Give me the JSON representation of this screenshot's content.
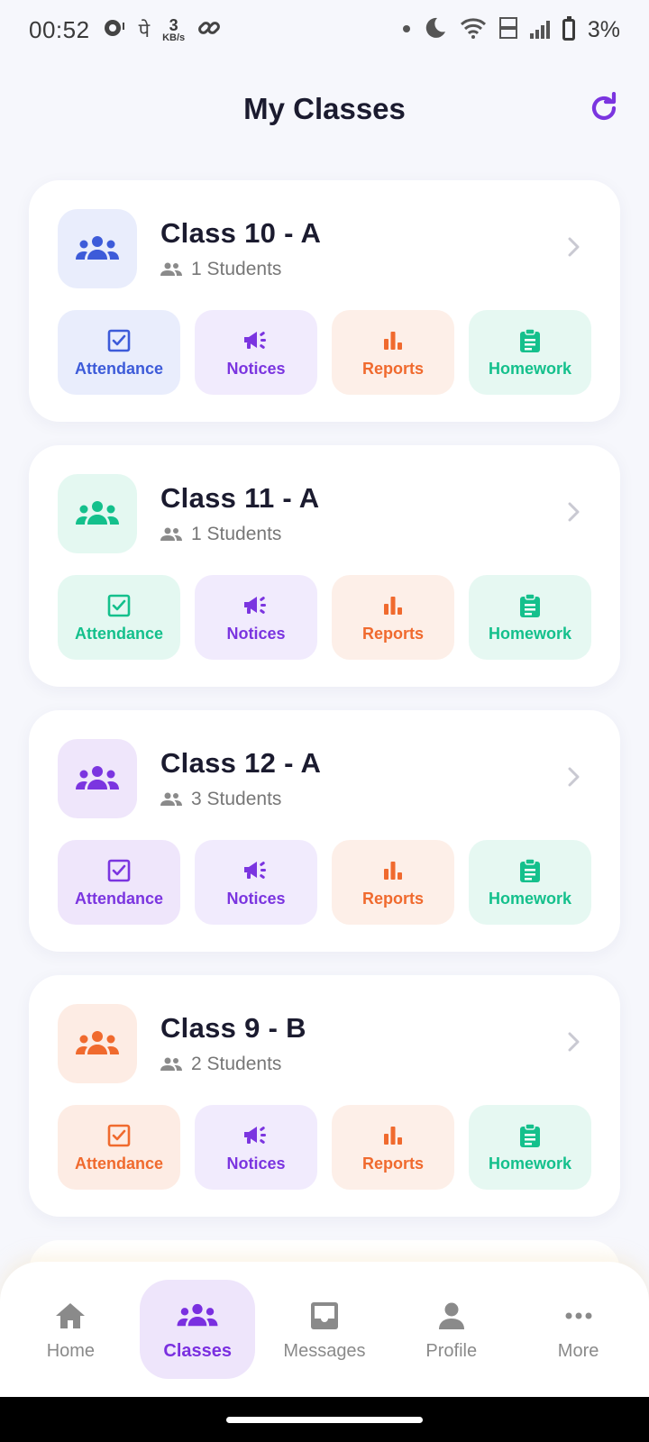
{
  "status_bar": {
    "time": "00:52",
    "net_speed_value": "3",
    "net_speed_unit": "KB/s",
    "hindi_glyph": "पे",
    "battery_percent": "3%"
  },
  "header": {
    "title": "My Classes",
    "refresh_icon": "refresh-icon"
  },
  "action_labels": {
    "attendance": "Attendance",
    "notices": "Notices",
    "reports": "Reports",
    "homework": "Homework"
  },
  "classes": [
    {
      "name": "Class 10 - A",
      "students": "1 Students",
      "accent": "#3d5bd9",
      "avatar_bg": "#e9edfc"
    },
    {
      "name": "Class 11 - A",
      "students": "1 Students",
      "accent": "#14c08c",
      "avatar_bg": "#e4f8f1"
    },
    {
      "name": "Class 12 - A",
      "students": "3 Students",
      "accent": "#7b35e0",
      "avatar_bg": "#efe6fb"
    },
    {
      "name": "Class 9 - B",
      "students": "2 Students",
      "accent": "#f06a2e",
      "avatar_bg": "#fdece4"
    }
  ],
  "colors": {
    "notices": "#7b35e0",
    "notices_bg": "#f1ebfd",
    "reports": "#f06a2e",
    "reports_bg": "#fdefe8",
    "homework": "#14c08c",
    "homework_bg": "#e6f8f2"
  },
  "bottom_nav": {
    "home": "Home",
    "classes": "Classes",
    "messages": "Messages",
    "profile": "Profile",
    "more": "More",
    "active": "classes"
  }
}
